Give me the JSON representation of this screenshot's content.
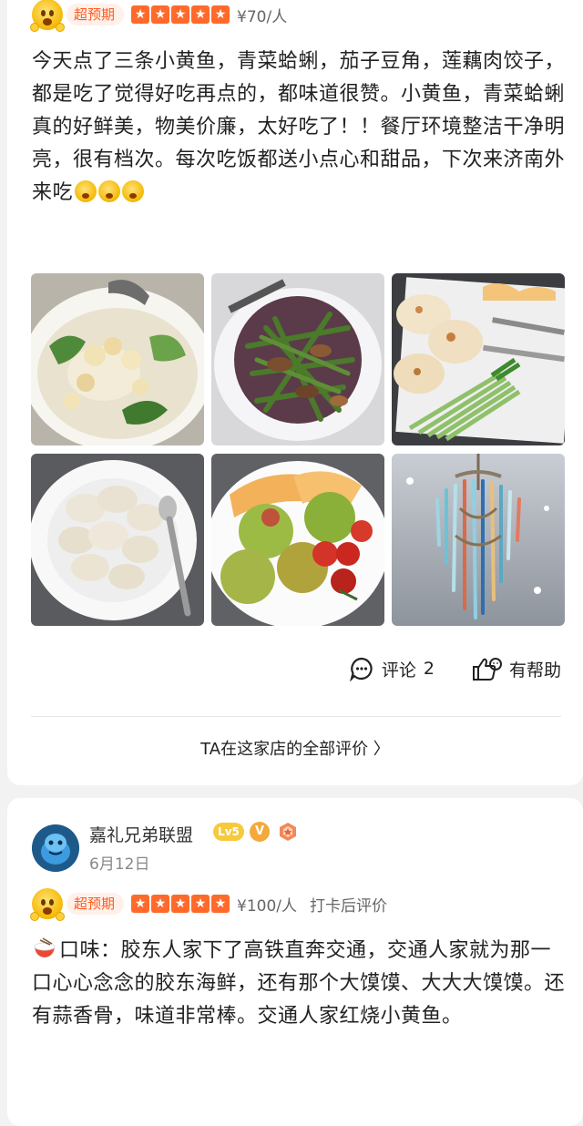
{
  "review1": {
    "tag": "超预期",
    "stars": 5,
    "price": "¥70/人",
    "text": "今天点了三条小黄鱼，青菜蛤蜊，茄子豆角，莲藕肉饺子，都是吃了觉得好吃再点的，都味道很赞。小黄鱼，青菜蛤蜊真的好鲜美，物美价廉，太好吃了！！餐厅环境整洁干净明亮，很有档次。每次吃饭都送小点心和甜品，下次来济南外来吃",
    "photos": [
      "clam-vegetable-soup",
      "eggplant-green-beans",
      "fried-buns-scallions",
      "dumplings",
      "lychee-melon-tomato-plate",
      "crystal-chandelier"
    ],
    "comment_label": "评论",
    "comment_count": "2",
    "helpful_label": "有帮助",
    "all_reviews_link": "TA在这家店的全部评价 〉"
  },
  "review2": {
    "username": "嘉礼兄弟联盟",
    "level": "Lv5",
    "v_badge": "V",
    "date": "6月12日",
    "tag": "超预期",
    "stars": 5,
    "price": "¥100/人",
    "extra": "打卡后评价",
    "text": "口味：胶东人家下了高铁直奔交通，交通人家就为那一口心心念念的胶东海鲜，还有那个大馍馍、大大大馍馍。还有蒜香骨，味道非常棒。交通人家红烧小黄鱼。"
  },
  "colors": {
    "accent": "#ff6a2b",
    "tag_text": "#ff5b1f",
    "tag_bg": "#fff1ea"
  }
}
